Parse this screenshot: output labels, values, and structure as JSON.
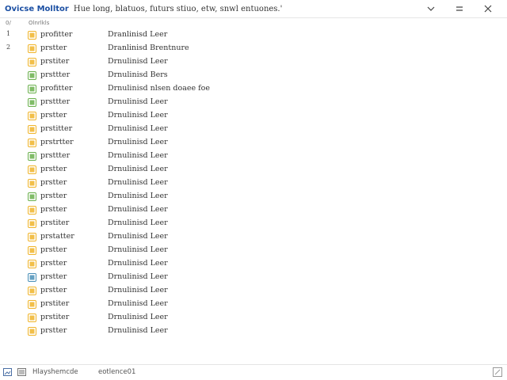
{
  "titlebar": {
    "app_name": "Ovicse Molltor",
    "subtitle": "Hue long, blatuos, futurs stiuo, etw, snwl entuones.'",
    "controls": {
      "minimize_icon": "chevron-down-icon",
      "maximize_icon": "maximize-icon",
      "close_icon": "close-icon"
    }
  },
  "columns": {
    "number": "0/",
    "name": "Olnrlkls"
  },
  "rows": [
    {
      "num": "1",
      "name": "profitter",
      "type": "Dranlinisd Leer",
      "icon_color": "#f0b429"
    },
    {
      "num": "2",
      "name": "prstter",
      "type": "Dranlinisd Brentnure",
      "icon_color": "#f0b429"
    },
    {
      "num": "",
      "name": "prstiter",
      "type": "Drnulinisd Leer",
      "icon_color": "#f0b429"
    },
    {
      "num": "",
      "name": "prsttter",
      "type": "Drnulinisd Bers",
      "icon_color": "#6ab04c"
    },
    {
      "num": "",
      "name": "profitter",
      "type": "Drnulinisd nlsen doaee foe",
      "icon_color": "#6ab04c"
    },
    {
      "num": "",
      "name": "prsttter",
      "type": "Drnulinisd Leer",
      "icon_color": "#6ab04c"
    },
    {
      "num": "",
      "name": "prstter",
      "type": "Drnulinisd Leer",
      "icon_color": "#f0b429"
    },
    {
      "num": "",
      "name": "prstitter",
      "type": "Drnulinisd Leer",
      "icon_color": "#f0b429"
    },
    {
      "num": "",
      "name": "prstrtter",
      "type": "Drnulinisd Leer",
      "icon_color": "#f0b429"
    },
    {
      "num": "",
      "name": "prsttter",
      "type": "Drnulinisd Leer",
      "icon_color": "#6ab04c"
    },
    {
      "num": "",
      "name": "prstter",
      "type": "Drnulinisd Leer",
      "icon_color": "#f0b429"
    },
    {
      "num": "",
      "name": "prstter",
      "type": "Drnulinisd Leer",
      "icon_color": "#f0b429"
    },
    {
      "num": "",
      "name": "prstter",
      "type": "Drnulinisd Leer",
      "icon_color": "#6ab04c"
    },
    {
      "num": "",
      "name": "prstter",
      "type": "Drnulinisd Leer",
      "icon_color": "#f0b429"
    },
    {
      "num": "",
      "name": "prstiter",
      "type": "Drnulinisd Leer",
      "icon_color": "#f0b429"
    },
    {
      "num": "",
      "name": "prstatter",
      "type": "Drnulinisd Leer",
      "icon_color": "#f0b429"
    },
    {
      "num": "",
      "name": "prstter",
      "type": "Drnulinisd Leer",
      "icon_color": "#f0b429"
    },
    {
      "num": "",
      "name": "prstter",
      "type": "Drnulinisd Leer",
      "icon_color": "#f0b429"
    },
    {
      "num": "",
      "name": "prstter",
      "type": "Drnulinisd Leer",
      "icon_color": "#4a90b8"
    },
    {
      "num": "",
      "name": "prstter",
      "type": "Drnulinisd Leer",
      "icon_color": "#f0b429"
    },
    {
      "num": "",
      "name": "prstiter",
      "type": "Drnulinisd Leer",
      "icon_color": "#f0b429"
    },
    {
      "num": "",
      "name": "prstiter",
      "type": "Drnulinisd Leer",
      "icon_color": "#f0b429"
    },
    {
      "num": "",
      "name": "prstter",
      "type": "Drnulinisd Leer",
      "icon_color": "#f0b429"
    }
  ],
  "statusbar": {
    "text1": "Hlayshemcde",
    "text2": "eotlence01"
  },
  "colors": {
    "accent": "#1b4fa3",
    "folder": "#f0b429",
    "green": "#6ab04c"
  }
}
